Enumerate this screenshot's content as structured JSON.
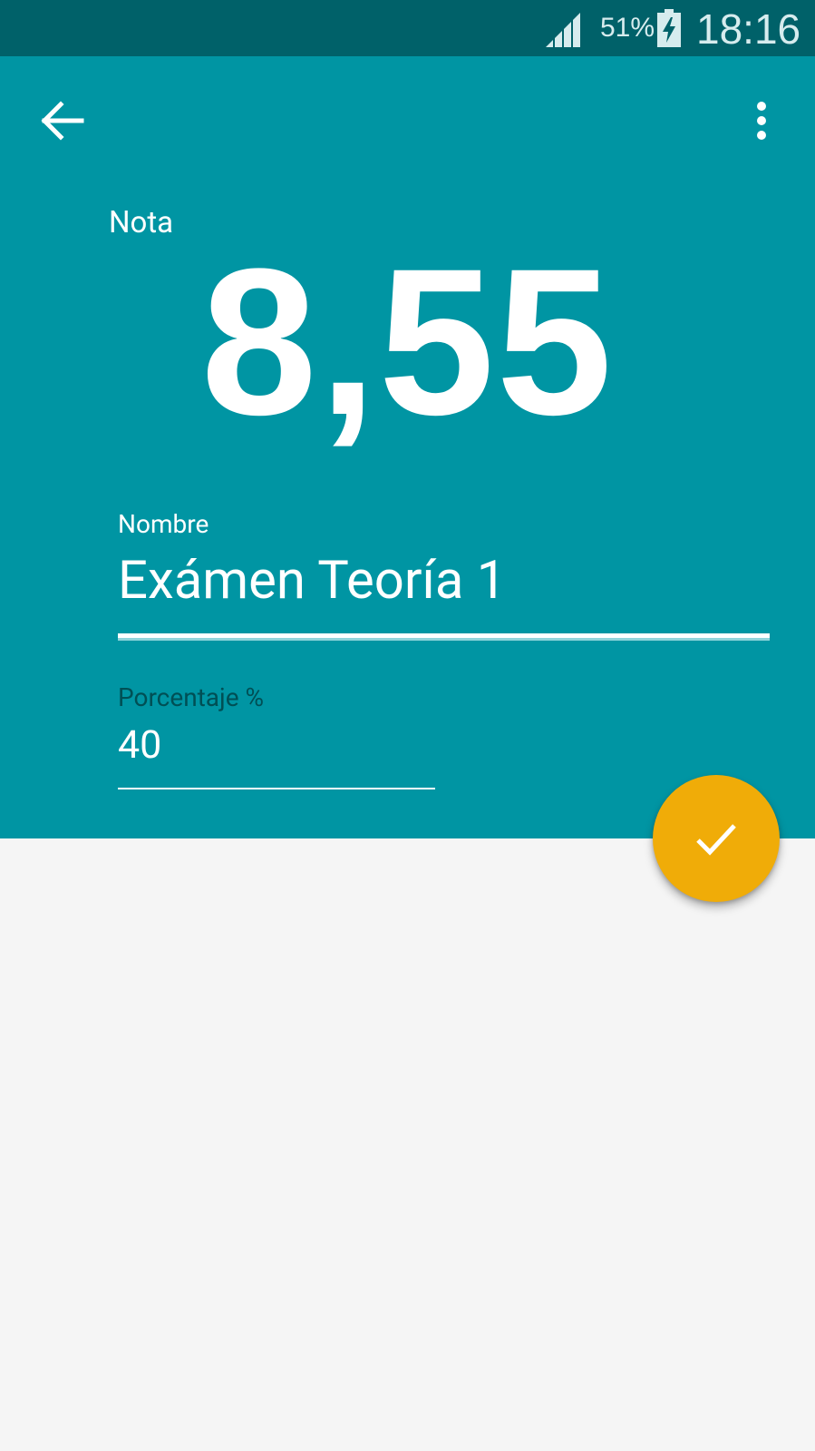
{
  "status_bar": {
    "battery_percent": "51%",
    "time": "18:16",
    "signal_icon": "cell-signal-icon",
    "battery_icon": "battery-charging-icon"
  },
  "toolbar": {
    "back_icon": "arrow-back-icon",
    "more_icon": "more-vert-icon"
  },
  "grade": {
    "label": "Nota",
    "value": "8,55"
  },
  "form": {
    "name": {
      "label": "Nombre",
      "value": "Exámen Teoría 1"
    },
    "percentage": {
      "label": "Porcentaje %",
      "value": "40"
    }
  },
  "fab": {
    "icon": "check-icon"
  },
  "colors": {
    "status_bar": "#006169",
    "primary": "#0095a3",
    "accent": "#f0ac08",
    "background": "#f5f5f5",
    "secondary_label": "#004f55"
  }
}
